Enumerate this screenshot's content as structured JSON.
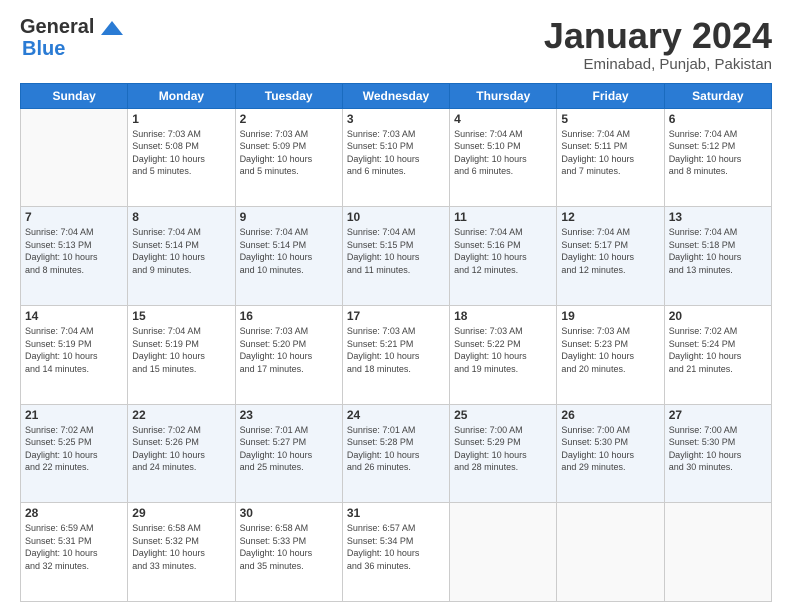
{
  "header": {
    "logo_line1": "General",
    "logo_line2": "Blue",
    "month_title": "January 2024",
    "location": "Eminabad, Punjab, Pakistan"
  },
  "days_of_week": [
    "Sunday",
    "Monday",
    "Tuesday",
    "Wednesday",
    "Thursday",
    "Friday",
    "Saturday"
  ],
  "weeks": [
    [
      {
        "day": "",
        "info": ""
      },
      {
        "day": "1",
        "info": "Sunrise: 7:03 AM\nSunset: 5:08 PM\nDaylight: 10 hours\nand 5 minutes."
      },
      {
        "day": "2",
        "info": "Sunrise: 7:03 AM\nSunset: 5:09 PM\nDaylight: 10 hours\nand 5 minutes."
      },
      {
        "day": "3",
        "info": "Sunrise: 7:03 AM\nSunset: 5:10 PM\nDaylight: 10 hours\nand 6 minutes."
      },
      {
        "day": "4",
        "info": "Sunrise: 7:04 AM\nSunset: 5:10 PM\nDaylight: 10 hours\nand 6 minutes."
      },
      {
        "day": "5",
        "info": "Sunrise: 7:04 AM\nSunset: 5:11 PM\nDaylight: 10 hours\nand 7 minutes."
      },
      {
        "day": "6",
        "info": "Sunrise: 7:04 AM\nSunset: 5:12 PM\nDaylight: 10 hours\nand 8 minutes."
      }
    ],
    [
      {
        "day": "7",
        "info": "Sunrise: 7:04 AM\nSunset: 5:13 PM\nDaylight: 10 hours\nand 8 minutes."
      },
      {
        "day": "8",
        "info": "Sunrise: 7:04 AM\nSunset: 5:14 PM\nDaylight: 10 hours\nand 9 minutes."
      },
      {
        "day": "9",
        "info": "Sunrise: 7:04 AM\nSunset: 5:14 PM\nDaylight: 10 hours\nand 10 minutes."
      },
      {
        "day": "10",
        "info": "Sunrise: 7:04 AM\nSunset: 5:15 PM\nDaylight: 10 hours\nand 11 minutes."
      },
      {
        "day": "11",
        "info": "Sunrise: 7:04 AM\nSunset: 5:16 PM\nDaylight: 10 hours\nand 12 minutes."
      },
      {
        "day": "12",
        "info": "Sunrise: 7:04 AM\nSunset: 5:17 PM\nDaylight: 10 hours\nand 12 minutes."
      },
      {
        "day": "13",
        "info": "Sunrise: 7:04 AM\nSunset: 5:18 PM\nDaylight: 10 hours\nand 13 minutes."
      }
    ],
    [
      {
        "day": "14",
        "info": "Sunrise: 7:04 AM\nSunset: 5:19 PM\nDaylight: 10 hours\nand 14 minutes."
      },
      {
        "day": "15",
        "info": "Sunrise: 7:04 AM\nSunset: 5:19 PM\nDaylight: 10 hours\nand 15 minutes."
      },
      {
        "day": "16",
        "info": "Sunrise: 7:03 AM\nSunset: 5:20 PM\nDaylight: 10 hours\nand 17 minutes."
      },
      {
        "day": "17",
        "info": "Sunrise: 7:03 AM\nSunset: 5:21 PM\nDaylight: 10 hours\nand 18 minutes."
      },
      {
        "day": "18",
        "info": "Sunrise: 7:03 AM\nSunset: 5:22 PM\nDaylight: 10 hours\nand 19 minutes."
      },
      {
        "day": "19",
        "info": "Sunrise: 7:03 AM\nSunset: 5:23 PM\nDaylight: 10 hours\nand 20 minutes."
      },
      {
        "day": "20",
        "info": "Sunrise: 7:02 AM\nSunset: 5:24 PM\nDaylight: 10 hours\nand 21 minutes."
      }
    ],
    [
      {
        "day": "21",
        "info": "Sunrise: 7:02 AM\nSunset: 5:25 PM\nDaylight: 10 hours\nand 22 minutes."
      },
      {
        "day": "22",
        "info": "Sunrise: 7:02 AM\nSunset: 5:26 PM\nDaylight: 10 hours\nand 24 minutes."
      },
      {
        "day": "23",
        "info": "Sunrise: 7:01 AM\nSunset: 5:27 PM\nDaylight: 10 hours\nand 25 minutes."
      },
      {
        "day": "24",
        "info": "Sunrise: 7:01 AM\nSunset: 5:28 PM\nDaylight: 10 hours\nand 26 minutes."
      },
      {
        "day": "25",
        "info": "Sunrise: 7:00 AM\nSunset: 5:29 PM\nDaylight: 10 hours\nand 28 minutes."
      },
      {
        "day": "26",
        "info": "Sunrise: 7:00 AM\nSunset: 5:30 PM\nDaylight: 10 hours\nand 29 minutes."
      },
      {
        "day": "27",
        "info": "Sunrise: 7:00 AM\nSunset: 5:30 PM\nDaylight: 10 hours\nand 30 minutes."
      }
    ],
    [
      {
        "day": "28",
        "info": "Sunrise: 6:59 AM\nSunset: 5:31 PM\nDaylight: 10 hours\nand 32 minutes."
      },
      {
        "day": "29",
        "info": "Sunrise: 6:58 AM\nSunset: 5:32 PM\nDaylight: 10 hours\nand 33 minutes."
      },
      {
        "day": "30",
        "info": "Sunrise: 6:58 AM\nSunset: 5:33 PM\nDaylight: 10 hours\nand 35 minutes."
      },
      {
        "day": "31",
        "info": "Sunrise: 6:57 AM\nSunset: 5:34 PM\nDaylight: 10 hours\nand 36 minutes."
      },
      {
        "day": "",
        "info": ""
      },
      {
        "day": "",
        "info": ""
      },
      {
        "day": "",
        "info": ""
      }
    ]
  ]
}
